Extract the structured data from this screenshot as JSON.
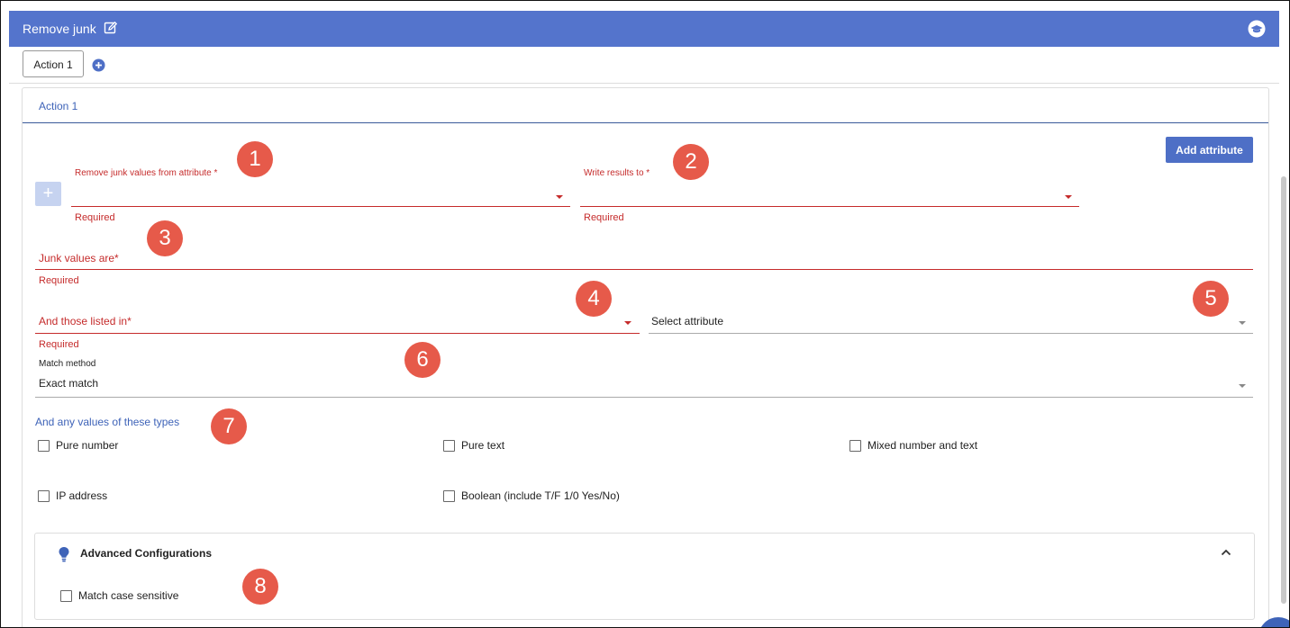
{
  "header": {
    "title": "Remove junk"
  },
  "tabs": {
    "items": [
      {
        "label": "Action 1"
      }
    ]
  },
  "panel": {
    "title": "Action 1"
  },
  "toolbar": {
    "add_attribute_label": "Add attribute"
  },
  "fields": {
    "remove_from": {
      "label": "Remove junk values from attribute *",
      "error": "Required"
    },
    "write_to": {
      "label": "Write results to *",
      "error": "Required"
    },
    "junk_values": {
      "label": "Junk values are*",
      "error": "Required"
    },
    "listed_in": {
      "label": "And those listed in*",
      "error": "Required"
    },
    "select_attribute": {
      "value": "Select attribute"
    },
    "match_method": {
      "label": "Match method",
      "value": "Exact match"
    }
  },
  "types": {
    "label": "And any values of these types",
    "options": [
      "Pure number",
      "Pure text",
      "Mixed number and text",
      "IP address",
      "Boolean (include T/F 1/0 Yes/No)"
    ]
  },
  "advanced": {
    "title": "Advanced Configurations",
    "match_case": "Match case sensitive"
  },
  "badges": [
    "1",
    "2",
    "3",
    "4",
    "5",
    "6",
    "7",
    "8"
  ],
  "colors": {
    "header": "#5474cc",
    "accent": "#3e63b8",
    "error": "#c52b2b",
    "badge": "#e65a4a"
  },
  "icons": [
    "edit-icon",
    "graduation-cap-icon",
    "plus-circle-icon",
    "plus-icon",
    "dropdown-caret-icon",
    "lightbulb-icon",
    "chevron-up-icon"
  ]
}
